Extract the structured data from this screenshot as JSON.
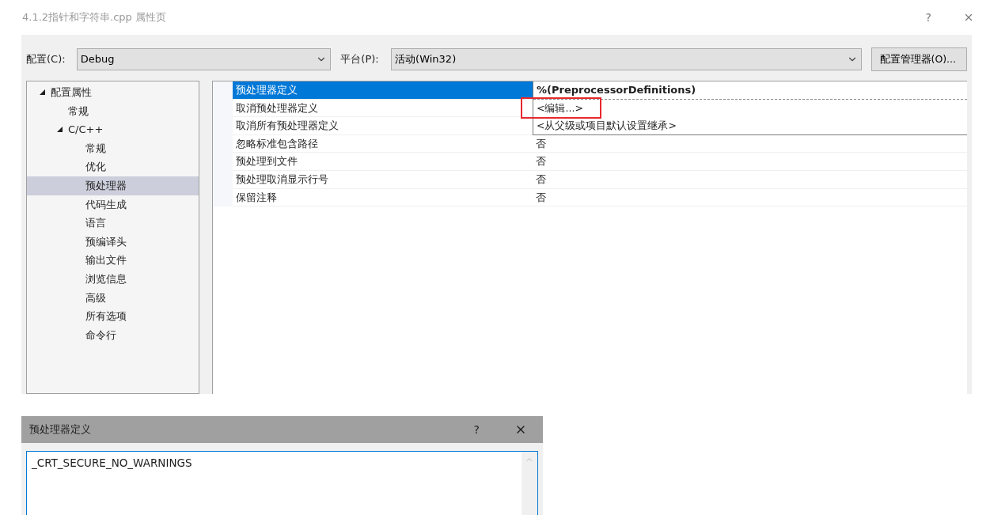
{
  "window": {
    "title": "4.1.2指针和字符串.cpp 属性页",
    "help": "?"
  },
  "config": {
    "label": "配置(C):",
    "value": "Debug"
  },
  "platform": {
    "label": "平台(P):",
    "value": "活动(Win32)"
  },
  "manager_button": "配置管理器(O)...",
  "tree": [
    {
      "label": "配置属性",
      "expanded": true,
      "selected": false,
      "children": [
        {
          "label": "常规",
          "selected": false
        },
        {
          "label": "C/C++",
          "expanded": true,
          "selected": false,
          "children": [
            {
              "label": "常规",
              "selected": false
            },
            {
              "label": "优化",
              "selected": false
            },
            {
              "label": "预处理器",
              "selected": true
            },
            {
              "label": "代码生成",
              "selected": false
            },
            {
              "label": "语言",
              "selected": false
            },
            {
              "label": "预编译头",
              "selected": false
            },
            {
              "label": "输出文件",
              "selected": false
            },
            {
              "label": "浏览信息",
              "selected": false
            },
            {
              "label": "高级",
              "selected": false
            },
            {
              "label": "所有选项",
              "selected": false
            },
            {
              "label": "命令行",
              "selected": false
            }
          ]
        }
      ]
    }
  ],
  "properties": [
    {
      "name": "预处理器定义",
      "selected": true
    },
    {
      "name": "取消预处理器定义",
      "selected": false
    },
    {
      "name": "取消所有预处理器定义",
      "selected": false
    },
    {
      "name": "忽略标准包含路径",
      "value": "否",
      "selected": false
    },
    {
      "name": "预处理到文件",
      "value": "否",
      "selected": false
    },
    {
      "name": "预处理取消显示行号",
      "value": "否",
      "selected": false
    },
    {
      "name": "保留注释",
      "value": "否",
      "selected": false
    }
  ],
  "dropdown": {
    "value": "%(PreprocessorDefinitions)",
    "options": [
      {
        "label": "<编辑...>",
        "highlighted": true
      },
      {
        "label": "<从父级或项目默认设置继承>",
        "highlighted": false
      }
    ]
  },
  "dialog": {
    "title": "预处理器定义",
    "help": "?",
    "text": "_CRT_SECURE_NO_WARNINGS"
  }
}
